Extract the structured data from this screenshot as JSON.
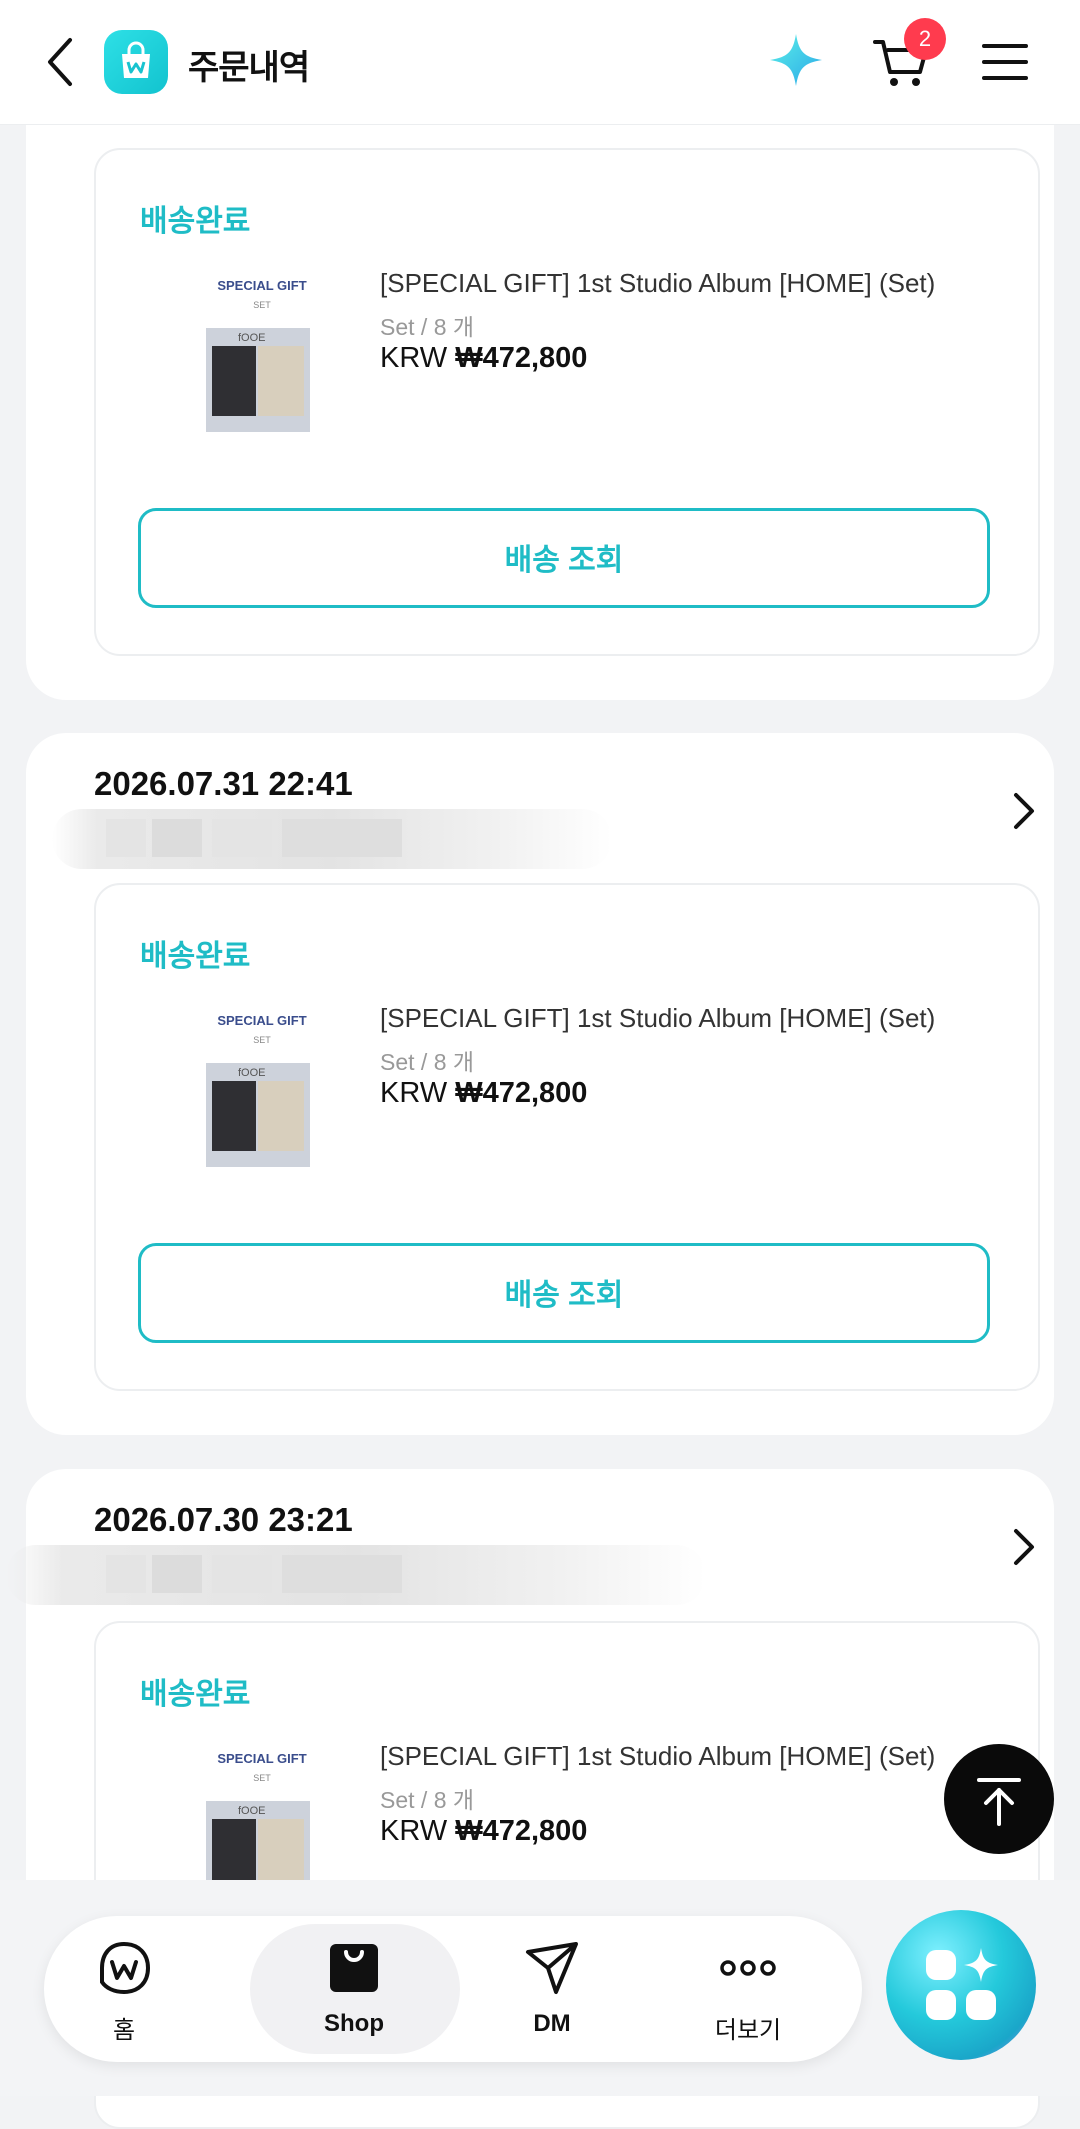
{
  "header": {
    "title": "주문내역",
    "cart_count": "2"
  },
  "orders": [
    {
      "date": "",
      "status": "배송완료",
      "thumb_title": "SPECIAL GIFT",
      "thumb_sub": "SET",
      "product_name": "[SPECIAL GIFT] 1st Studio Album [HOME] (Set)",
      "option": "Set / 8 개",
      "currency": "KRW",
      "price": "₩472,800",
      "track_label": "배송 조회"
    },
    {
      "date": "2026.07.31 22:41",
      "status": "배송완료",
      "thumb_title": "SPECIAL GIFT",
      "thumb_sub": "SET",
      "product_name": "[SPECIAL GIFT] 1st Studio Album [HOME] (Set)",
      "option": "Set / 8 개",
      "currency": "KRW",
      "price": "₩472,800",
      "track_label": "배송 조회"
    },
    {
      "date": "2026.07.30 23:21",
      "status": "배송완료",
      "thumb_title": "SPECIAL GIFT",
      "thumb_sub": "SET",
      "product_name": "[SPECIAL GIFT] 1st Studio Album [HOME] (Set)",
      "option": "Set / 8 개",
      "currency": "KRW",
      "price": "₩472,800"
    }
  ],
  "nav": {
    "home": "홈",
    "shop": "Shop",
    "dm": "DM",
    "more": "더보기"
  },
  "colors": {
    "accent": "#1fbcc6",
    "badge": "#ff3b4e"
  },
  "icons": [
    "back-arrow-icon",
    "weverse-shop-icon",
    "sparkle-icon",
    "cart-icon",
    "hamburger-menu-icon",
    "chevron-right-icon",
    "arrow-up-to-top-icon",
    "home-icon",
    "shop-bag-icon",
    "dm-paper-plane-icon",
    "more-dots-icon",
    "apps-fab-icon"
  ]
}
